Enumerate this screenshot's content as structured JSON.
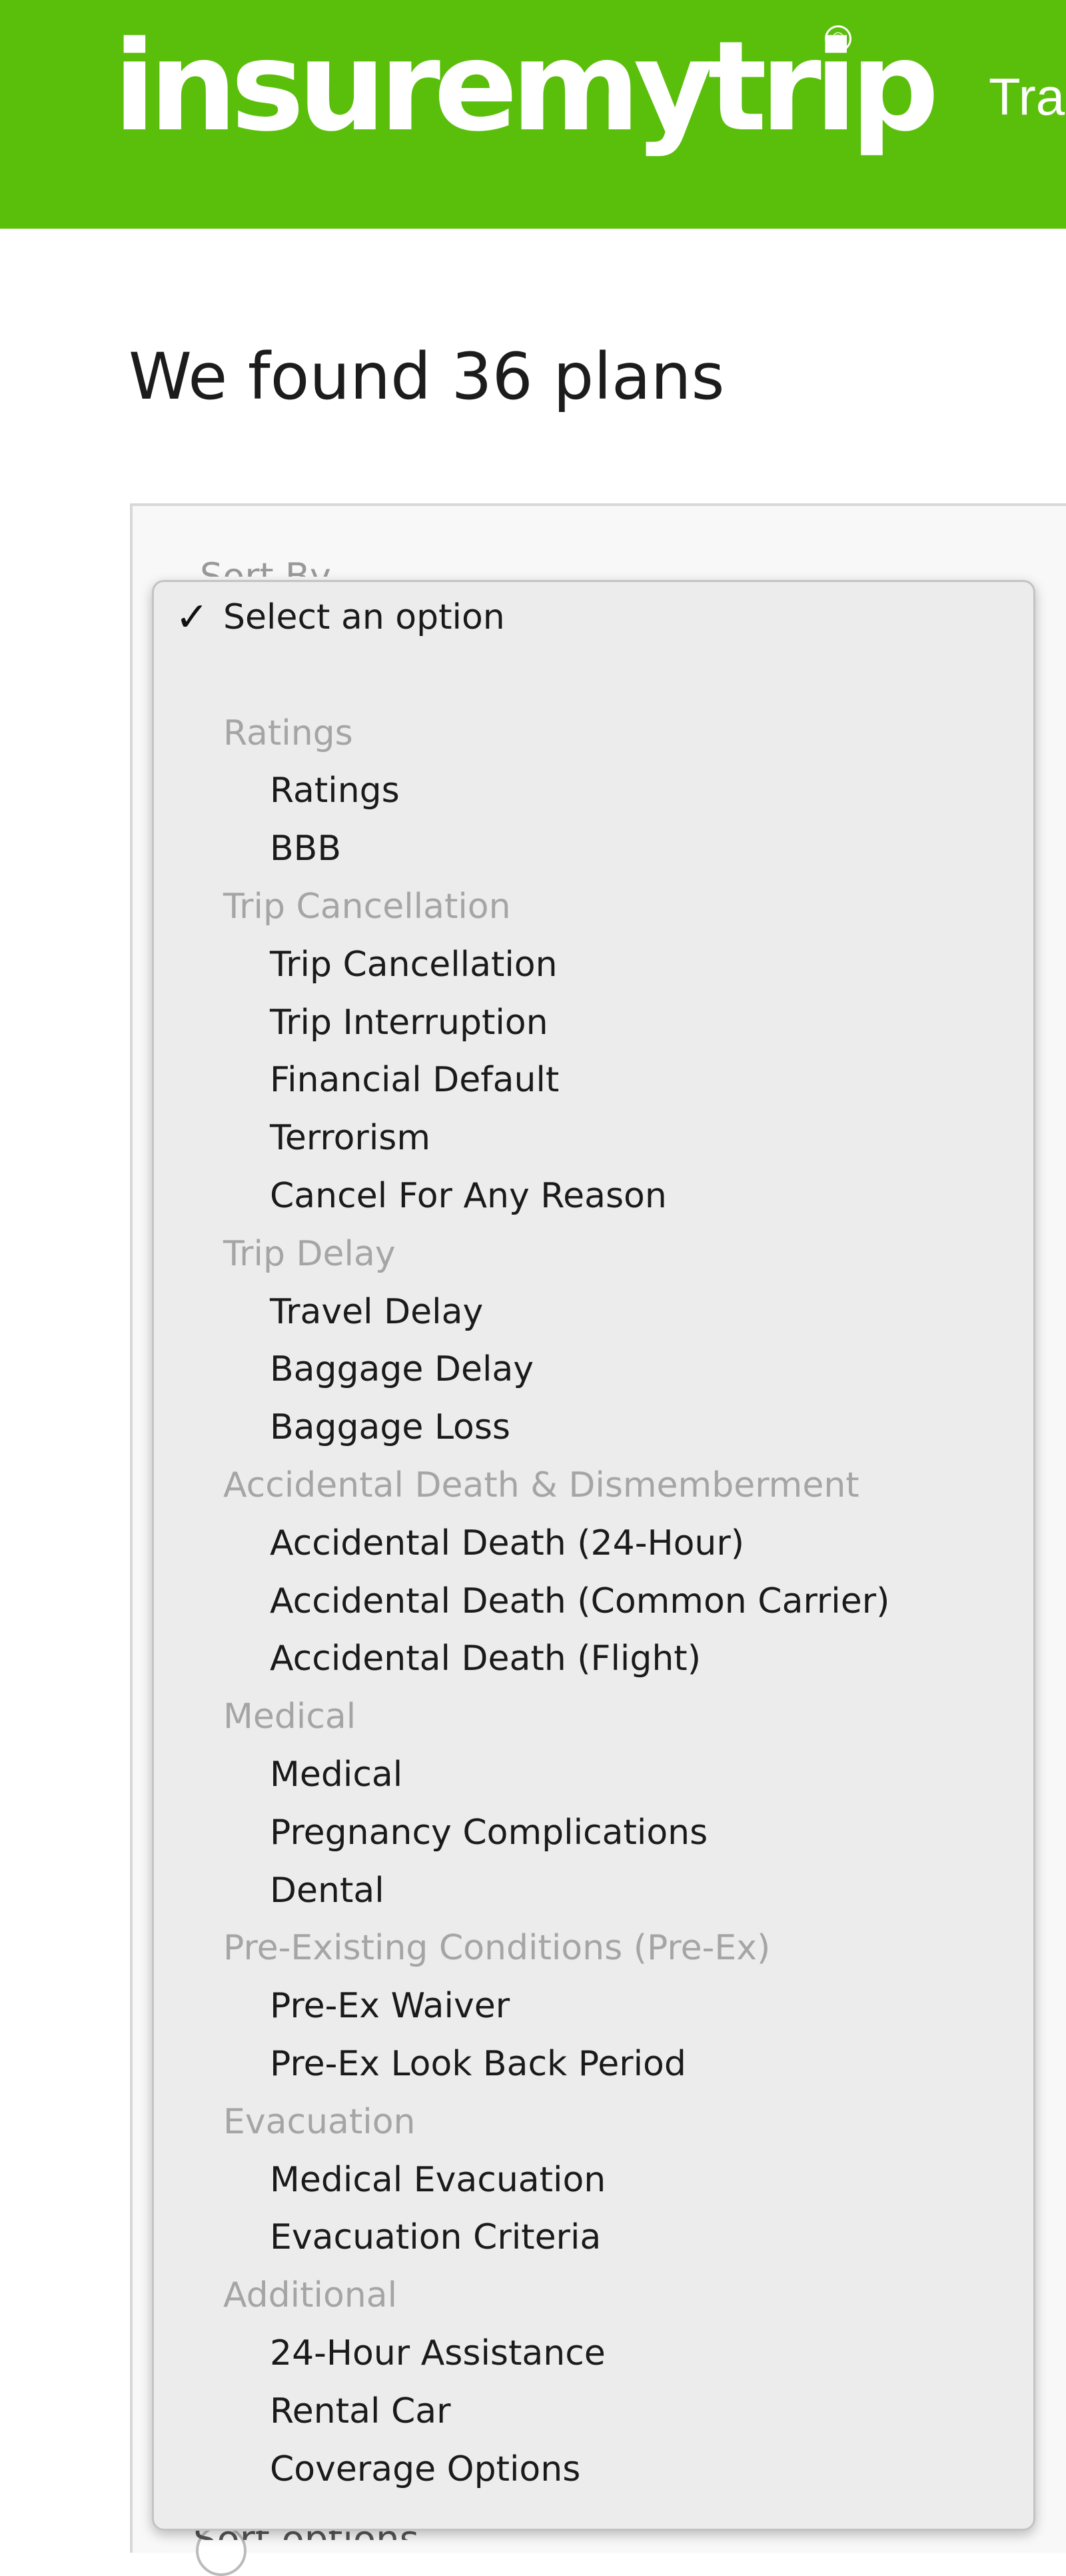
{
  "header": {
    "logo_text": "insuremytrip",
    "logo_mark": "®",
    "nav_partial": "Tra",
    "brand_color": "#5abf0b"
  },
  "main": {
    "results_heading": "We found 36 plans",
    "obscured_top_text": "Sort By",
    "obscured_bottom_text": "Sort options"
  },
  "sort_dropdown": {
    "selected_marker": "✓",
    "selected_label": "Select an option",
    "groups": [
      {
        "label": "Ratings",
        "options": [
          "Ratings",
          "BBB"
        ]
      },
      {
        "label": "Trip Cancellation",
        "options": [
          "Trip Cancellation",
          "Trip Interruption",
          "Financial Default",
          "Terrorism",
          "Cancel For Any Reason"
        ]
      },
      {
        "label": "Trip Delay",
        "options": [
          "Travel Delay",
          "Baggage Delay",
          "Baggage Loss"
        ]
      },
      {
        "label": "Accidental Death & Dismemberment",
        "options": [
          "Accidental Death (24-Hour)",
          "Accidental Death (Common Carrier)",
          "Accidental Death (Flight)"
        ]
      },
      {
        "label": "Medical",
        "options": [
          "Medical",
          "Pregnancy Complications",
          "Dental"
        ]
      },
      {
        "label": "Pre-Existing Conditions (Pre-Ex)",
        "options": [
          "Pre-Ex Waiver",
          "Pre-Ex Look Back Period"
        ]
      },
      {
        "label": "Evacuation",
        "options": [
          "Medical Evacuation",
          "Evacuation Criteria"
        ]
      },
      {
        "label": "Additional",
        "options": [
          "24-Hour Assistance",
          "Rental Car",
          "Coverage Options"
        ]
      }
    ]
  }
}
